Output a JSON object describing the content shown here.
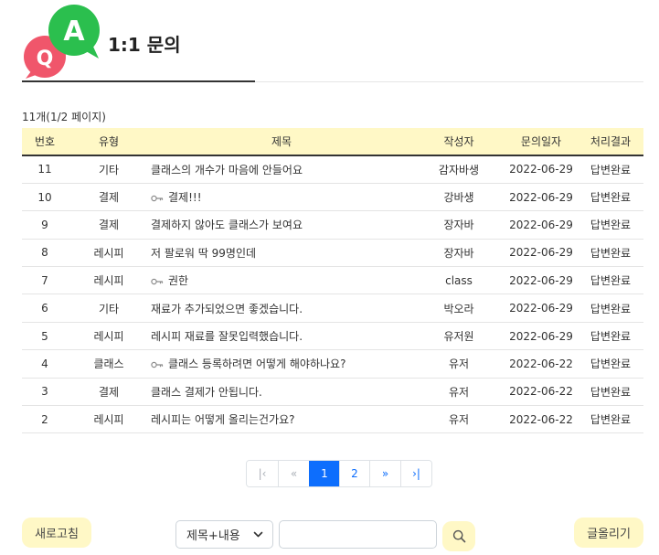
{
  "header": {
    "title": "1:1 문의"
  },
  "summary": "11개(1/2 페이지)",
  "table": {
    "columns": [
      "번호",
      "유형",
      "제목",
      "작성자",
      "문의일자",
      "처리결과"
    ],
    "rows": [
      {
        "no": "11",
        "type": "기타",
        "title": "클래스의 개수가 마음에 안들어요",
        "locked": false,
        "author": "감자바생",
        "date": "2022-06-29",
        "result": "답변완료"
      },
      {
        "no": "10",
        "type": "결제",
        "title": "결제!!!",
        "locked": true,
        "author": "강바생",
        "date": "2022-06-29",
        "result": "답변완료"
      },
      {
        "no": "9",
        "type": "결제",
        "title": "결제하지 않아도 클래스가 보여요",
        "locked": false,
        "author": "장자바",
        "date": "2022-06-29",
        "result": "답변완료"
      },
      {
        "no": "8",
        "type": "레시피",
        "title": "저 팔로워 딱 99명인데",
        "locked": false,
        "author": "장자바",
        "date": "2022-06-29",
        "result": "답변완료"
      },
      {
        "no": "7",
        "type": "레시피",
        "title": "권한",
        "locked": true,
        "author": "class",
        "date": "2022-06-29",
        "result": "답변완료"
      },
      {
        "no": "6",
        "type": "기타",
        "title": "재료가 추가되었으면 좋겠습니다.",
        "locked": false,
        "author": "박오라",
        "date": "2022-06-29",
        "result": "답변완료"
      },
      {
        "no": "5",
        "type": "레시피",
        "title": "레시피 재료를 잘못입력했습니다.",
        "locked": false,
        "author": "유저원",
        "date": "2022-06-29",
        "result": "답변완료"
      },
      {
        "no": "4",
        "type": "클래스",
        "title": "클래스 등록하려면 어떻게 해야하나요?",
        "locked": true,
        "author": "유저",
        "date": "2022-06-22",
        "result": "답변완료"
      },
      {
        "no": "3",
        "type": "결제",
        "title": "클래스 결제가 안됩니다.",
        "locked": false,
        "author": "유저",
        "date": "2022-06-22",
        "result": "답변완료"
      },
      {
        "no": "2",
        "type": "레시피",
        "title": "레시피는 어떻게 올리는건가요?",
        "locked": false,
        "author": "유저",
        "date": "2022-06-22",
        "result": "답변완료"
      }
    ]
  },
  "pagination": {
    "first": "|‹",
    "prev": "«",
    "pages": [
      "1",
      "2"
    ],
    "current": "1",
    "next": "»",
    "last": "›|"
  },
  "toolbar": {
    "refresh_label": "새로고침",
    "search_option": "제목+내용",
    "search_value": "",
    "write_label": "글올리기"
  },
  "colors": {
    "header_bg": "#fff8c6",
    "button_bg": "#fff8c6",
    "page_active": "#0d6efd",
    "logo_green": "#2bbf4e",
    "logo_pink": "#f0566b"
  },
  "icons": {
    "logo": "qa-bubbles-icon",
    "lock": "key-icon",
    "search": "search-icon",
    "dropdown": "chevron-down-icon"
  }
}
